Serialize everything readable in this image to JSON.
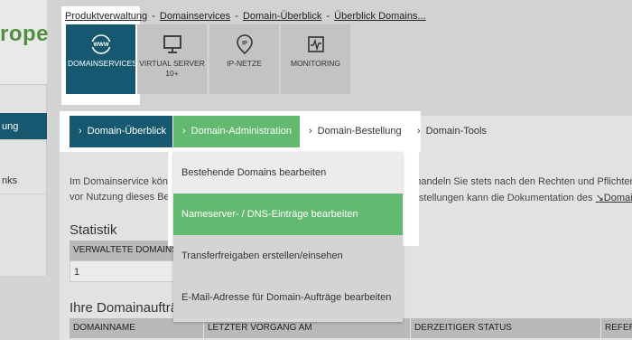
{
  "logo": {
    "text": "rope"
  },
  "sidebar": {
    "items": [
      {
        "label": "ung",
        "active": true
      },
      {
        "label": "nks",
        "active": false
      }
    ]
  },
  "breadcrumb": {
    "items": [
      "Produktverwaltung",
      "Domainservices",
      "Domain-Überblick",
      "Überblick Domains..."
    ],
    "separator": "-"
  },
  "tiles": [
    {
      "label": "DOMAINSERVICES",
      "icon": "www-globe-icon",
      "active": true
    },
    {
      "label": "VIRTUAL SERVER 10+",
      "icon": "monitor-icon",
      "active": false
    },
    {
      "label": "IP-NETZE",
      "icon": "ip-pin-icon",
      "active": false
    },
    {
      "label": "MONITORING",
      "icon": "pulse-icon",
      "active": false
    }
  ],
  "tabs": [
    {
      "label": "Domain-Überblick",
      "style": "dark"
    },
    {
      "label": "Domain-Administration",
      "style": "green"
    },
    {
      "label": "Domain-Bestellung",
      "style": "plain"
    },
    {
      "label": "Domain-Tools",
      "style": "plain"
    }
  ],
  "intro": {
    "line1_left": "Im Domainservice könne",
    "line1_right": "te handeln Sie stets nach den Rechten und Pflichten d",
    "line2_left": "vor Nutzung dieses Berei",
    "line2_right": "Einstellungen kann die Dokumentation des ",
    "line2_link": "↘Domain"
  },
  "statistik": {
    "title": "Statistik",
    "header": "VERWALTETE DOMAINS",
    "value": "1"
  },
  "auftraege": {
    "title": "Ihre Domainaufträ",
    "columns": [
      "DOMAINNAME",
      "LETZTER VORGANG AM",
      "DERZEITIGER STATUS",
      "REFER"
    ]
  },
  "dropdown": {
    "items": [
      "Bestehende Domains bearbeiten",
      "Nameserver- / DNS-Einträge bearbeiten",
      "Transferfreigaben erstellen/einsehen",
      "E-Mail-Adresse für Domain-Aufträge bearbeiten"
    ]
  },
  "colors": {
    "primary": "#15586f",
    "accent_green": "#63b96f",
    "logo_green": "#4f8f3f"
  }
}
